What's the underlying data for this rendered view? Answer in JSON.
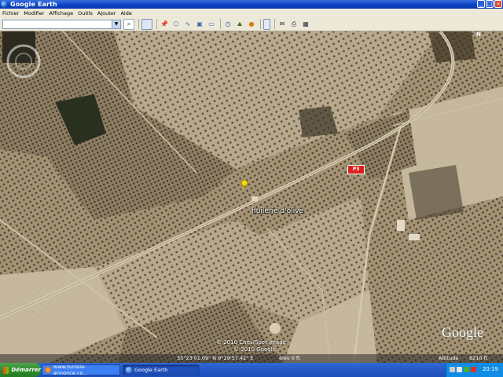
{
  "window": {
    "title": "Google Earth"
  },
  "menu": [
    "Fichier",
    "Modifier",
    "Affichage",
    "Outils",
    "Ajouter",
    "Aide"
  ],
  "toolbar": {
    "search_value": "",
    "icons": [
      "sidebar-icon",
      "placemark-icon",
      "polygon-icon",
      "path-icon",
      "overlay-icon",
      "record-tour-icon",
      "historical-imagery-icon",
      "sun-icon",
      "planets-icon",
      "ruler-icon",
      "email-icon",
      "print-icon",
      "view-in-maps-icon"
    ]
  },
  "map": {
    "placemark_label": "huilerie d'olive",
    "road_label": "P3",
    "copyright_1": "© 2010 Cnes/Spot Image",
    "copyright_2": "© 2010 Google",
    "logo": "Google",
    "compass_north": "N"
  },
  "status": {
    "coordinates": "35°23'01.09\" N   9°29'57.42\" E",
    "elevation": "élév    0 ft",
    "altitude_label": "Altitude",
    "altitude_value": "6210 ft"
  },
  "taskbar": {
    "start": "Démarrer",
    "tasks": [
      "www.tunisie-annonce.co...",
      "Google Earth"
    ],
    "clock": "20:19"
  },
  "colors": {
    "titlebar": "#0a3fc4",
    "taskbar": "#2459c7",
    "start": "#2c8a2a",
    "pin": "#f5d90a",
    "road_badge": "#d8211b"
  }
}
